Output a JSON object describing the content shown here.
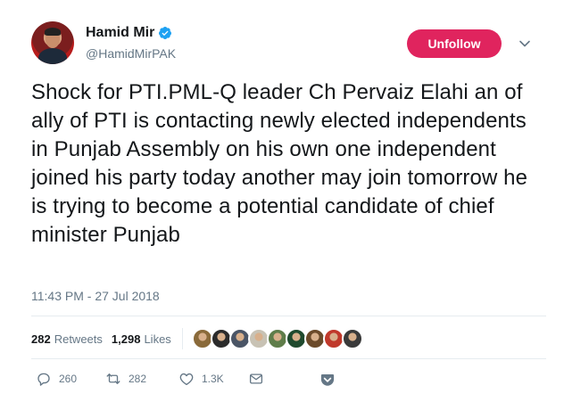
{
  "author": {
    "display_name": "Hamid Mir",
    "handle": "@HamidMirPAK",
    "verified": true
  },
  "follow_button_label": "Unfollow",
  "tweet": {
    "text": "Shock for PTI.PML-Q leader Ch Pervaiz Elahi an of ally of PTI is contacting newly elected independents in Punjab Assembly on his own one independent joined his party today another may join tomorrow he is trying to become a potential candidate of chief minister Punjab",
    "timestamp": "11:43 PM - 27 Jul 2018"
  },
  "stats": {
    "retweets_count": "282",
    "retweets_label": "Retweets",
    "likes_count": "1,298",
    "likes_label": "Likes"
  },
  "likers": [
    {
      "color": "#8a6a3a"
    },
    {
      "color": "#2b2b2b"
    },
    {
      "color": "#4a5566"
    },
    {
      "color": "#c8c2b4"
    },
    {
      "color": "#5f7d4a"
    },
    {
      "color": "#1f4a2e"
    },
    {
      "color": "#6b4a2a"
    },
    {
      "color": "#c0392b"
    },
    {
      "color": "#3a3a3a"
    }
  ],
  "actions": {
    "reply_count": "260",
    "retweet_count": "282",
    "like_count": "1.3K"
  },
  "colors": {
    "accent": "#1da1f2",
    "unfollow_bg": "#e0245e",
    "secondary_text": "#657786"
  }
}
